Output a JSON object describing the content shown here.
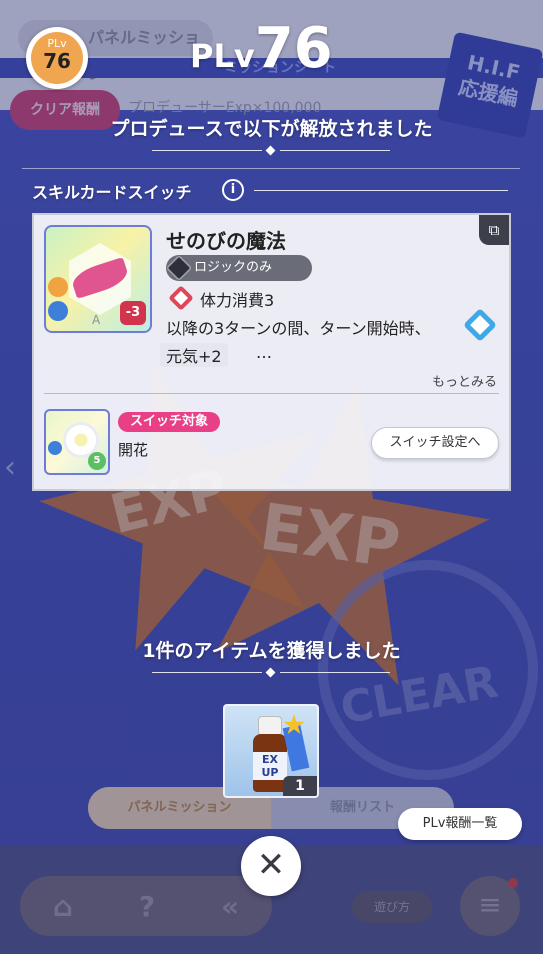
{
  "background": {
    "back_label": "パネルミッション",
    "sub_title": "ミッションシート",
    "clear_reward_label": "クリア報酬",
    "clear_reward_text": "プロデューサーExp×100,000",
    "badge_text": "H.I.F\n応援編",
    "exp_text_1": "EXP",
    "exp_text_2": "EXP",
    "seal_text": "CLEAR",
    "tab_panel_mission": "パネルミッション",
    "tab_reward_list": "報酬リスト",
    "howto_label": "遊び方",
    "nav_home_icon": "home-icon",
    "nav_help_icon": "help-icon",
    "nav_back_icon": "double-chevron-left-icon"
  },
  "header": {
    "plv_small_label": "PLv",
    "plv_small_value": "76",
    "plv_title_label": "PLv",
    "plv_title_value": "76"
  },
  "unlock": {
    "title": "プロデュースで以下が解放されました",
    "section_label": "スキルカードスイッチ",
    "info_icon": "i"
  },
  "skill_card": {
    "name": "せのびの魔法",
    "type_label": "ロジックのみ",
    "cost_label": "体力消費3",
    "effect_line1": "以降の3ターンの間、ターン開始時、",
    "effect_line2": "元気+2",
    "ellipsis": "…",
    "more_label": "もっとみる",
    "art_cost": "-3",
    "art_grade": "A",
    "switch_badge": "スイッチ対象",
    "switch_target_name": "開花",
    "switch_target_cost": "5",
    "switch_button_label": "スイッチ設定へ"
  },
  "item": {
    "title": "1件のアイテムを獲得しました",
    "bottle_label": "EX\nUP",
    "count": "1"
  },
  "buttons": {
    "reward_list_label": "PLv報酬一覧",
    "close_symbol": "✕"
  },
  "colors": {
    "accent_pink": "#e83f86",
    "plv_orange": "#f0a551",
    "stamina_red": "#e0465a",
    "effect_blue": "#3fa8e6"
  }
}
